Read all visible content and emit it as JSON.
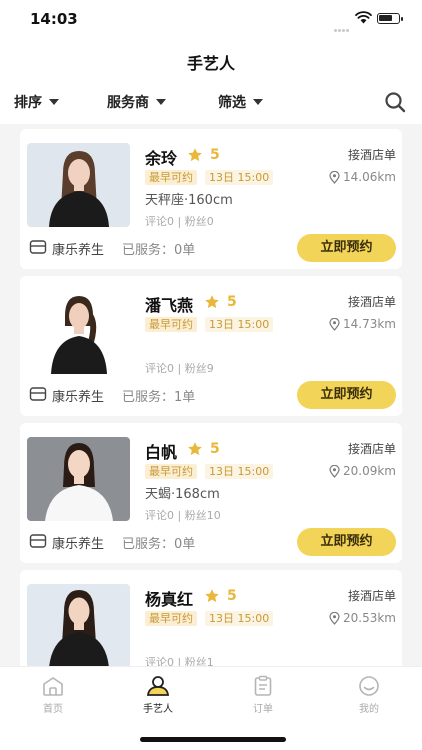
{
  "status_bar": {
    "time": "14:03"
  },
  "nav": {
    "title": "手艺人"
  },
  "filters": {
    "sort": "排序",
    "provider": "服务商",
    "filter": "筛选"
  },
  "colors": {
    "accent": "#f2d459",
    "star": "#e9b73a",
    "tag_bg": "#fbeed3"
  },
  "artisans": [
    {
      "name": "余玲",
      "rating": "5",
      "early_label": "最早可约",
      "early_time": "13日 15:00",
      "desc": "天秤座·160cm",
      "stats": "评论0 | 粉丝0",
      "accept": "接酒店单",
      "distance": "14.06km",
      "shop": "康乐养生",
      "served": "已服务：0单",
      "book": "立即预约"
    },
    {
      "name": "潘飞燕",
      "rating": "5",
      "early_label": "最早可约",
      "early_time": "13日 15:00",
      "desc": "",
      "stats": "评论0 | 粉丝9",
      "accept": "接酒店单",
      "distance": "14.73km",
      "shop": "康乐养生",
      "served": "已服务：1单",
      "book": "立即预约"
    },
    {
      "name": "白帆",
      "rating": "5",
      "early_label": "最早可约",
      "early_time": "13日 15:00",
      "desc": "天蝎·168cm",
      "stats": "评论0 | 粉丝10",
      "accept": "接酒店单",
      "distance": "20.09km",
      "shop": "康乐养生",
      "served": "已服务：0单",
      "book": "立即预约"
    },
    {
      "name": "杨真红",
      "rating": "5",
      "early_label": "最早可约",
      "early_time": "13日 15:00",
      "desc": "",
      "stats": "评论0 | 粉丝1",
      "accept": "接酒店单",
      "distance": "20.53km",
      "shop": "",
      "served": "",
      "book": ""
    }
  ],
  "tabbar": {
    "home": "首页",
    "artisans": "手艺人",
    "orders": "订单",
    "mine": "我的",
    "active": "artisans"
  }
}
